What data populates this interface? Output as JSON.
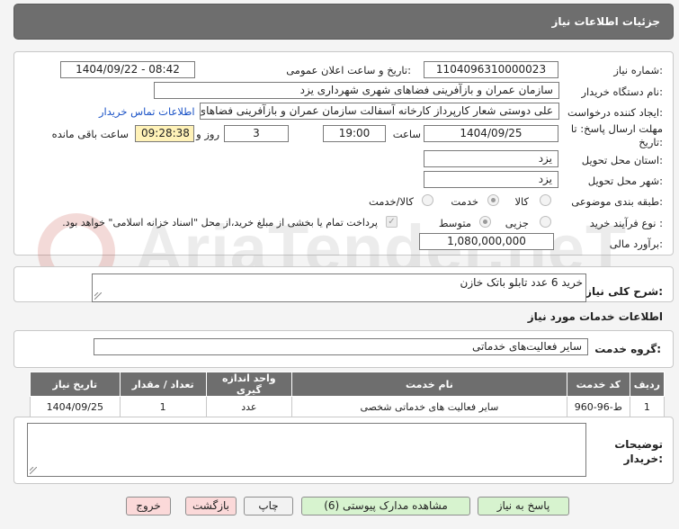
{
  "header": {
    "title": "جزئیات اطلاعات نیاز"
  },
  "form": {
    "need_number_label": "شماره نیاز:",
    "need_number": "1104096310000023",
    "announce_label": "تاریخ و ساعت اعلان عمومی:",
    "announce_value": "1404/09/22 - 08:42",
    "buyer_label": "نام دستگاه خریدار:",
    "buyer_value": "سازمان عمران و بازآفرینی فضاهای شهری شهرداری یزد",
    "creator_label": "ایجاد کننده درخواست:",
    "creator_value": "علی دوستی شعار کارپرداز کارخانه آسفالت سازمان عمران و بازآفرینی فضاهای",
    "contact_link": "اطلاعات تماس خریدار",
    "deadline_label": "مهلت ارسال پاسخ: تا تاریخ:",
    "deadline_date": "1404/09/25",
    "time_label": "ساعت",
    "deadline_time": "19:00",
    "days_value": "3",
    "days_label": "روز و",
    "remaining_time": "09:28:38",
    "remaining_label": "ساعت باقی مانده",
    "province_label": "استان محل تحویل:",
    "province_value": "یزد",
    "city_label": "شهر محل تحویل:",
    "city_value": "یزد",
    "category_label": "طبقه بندی موضوعی:",
    "category_options": [
      "کالا",
      "خدمت",
      "کالا/خدمت"
    ],
    "category_selected": "خدمت",
    "process_label": "نوع فرآیند خرید :",
    "process_options": [
      "جزیی",
      "متوسط"
    ],
    "process_selected": "متوسط",
    "payment_note": "پرداخت تمام یا بخشی از مبلغ خرید،از محل \"اسناد خزانه اسلامی\" خواهد بود.",
    "estimate_label": "برآورد مالی:",
    "estimate_value": "1,080,000,000"
  },
  "summary": {
    "label": "شرح کلی نیاز:",
    "value": "خرید 6 عدد تابلو باتک خازن"
  },
  "services": {
    "section_title": "اطلاعات خدمات مورد نیاز",
    "group_label": "گروه خدمت:",
    "group_value": "سایر فعالیت‌های خدماتی",
    "columns": [
      "ردیف",
      "کد خدمت",
      "نام خدمت",
      "واحد اندازه گیری",
      "تعداد / مقدار",
      "تاریخ نیاز"
    ],
    "rows": [
      [
        "1",
        "ط-96-960",
        "سایر فعالیت های خدماتی شخصی",
        "عدد",
        "1",
        "1404/09/25"
      ]
    ]
  },
  "buyer_notes": {
    "label": "توضیحات خریدار:",
    "value": ""
  },
  "buttons": {
    "reply": "پاسخ به نیاز",
    "view_docs": "مشاهده مدارک پیوستی (6)",
    "print": "چاپ",
    "back": "بازگشت",
    "exit": "خروج"
  },
  "watermark": {
    "text": "AriaTender.neT"
  },
  "colors": {
    "link": "#1a52c6",
    "time_bg": "#fff2b8",
    "header_bg": "#6e6e6e"
  }
}
